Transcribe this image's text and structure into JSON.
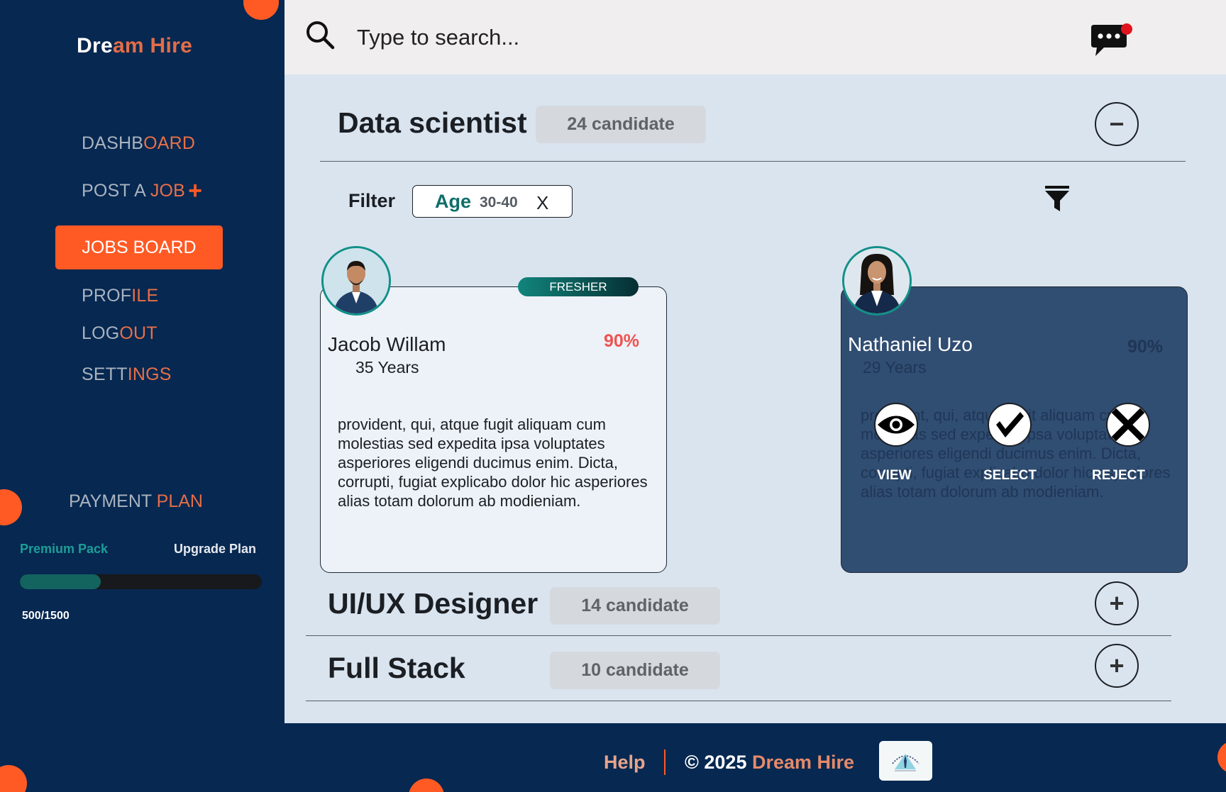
{
  "brand": {
    "part1": "Dre",
    "part2": "am Hire"
  },
  "nav": {
    "dashboard": {
      "a": "DASHB",
      "b": "OARD"
    },
    "post_job": {
      "a": "POST A ",
      "b": "JOB",
      "plus": "+"
    },
    "jobs_board": "JOBS BOARD",
    "profile": {
      "a": "PROF",
      "b": "ILE"
    },
    "logout": {
      "a": "LOG",
      "b": "OUT"
    },
    "settings": {
      "a": "SETT",
      "b": "INGS"
    }
  },
  "payment": {
    "title_a": "PAYMENT ",
    "title_b": "PLAN",
    "plan_name": "Premium Pack",
    "upgrade_label": "Upgrade Plan",
    "used": 500,
    "total": 1500,
    "usage_text": "500/1500"
  },
  "search": {
    "placeholder": "Type to search..."
  },
  "notifications": {
    "has_unread": true
  },
  "sections": [
    {
      "title": "Data scientist",
      "count": "24 candidate",
      "toggle": "−",
      "expanded": true
    },
    {
      "title": "UI/UX Designer",
      "count": "14 candidate",
      "toggle": "+",
      "expanded": false
    },
    {
      "title": "Full Stack",
      "count": "10 candidate",
      "toggle": "+",
      "expanded": false
    }
  ],
  "filter": {
    "label": "Filter",
    "chip_key": "Age",
    "chip_value": "30-40",
    "chip_remove": "X"
  },
  "candidates": [
    {
      "badge": "FRESHER",
      "name": "Jacob Willam",
      "age": "35 Years",
      "match": "90%",
      "bio": "provident, qui, atque fugit aliquam cum molestias sed expedita ipsa voluptates asperiores eligendi  ducimus enim. Dicta, corrupti, fugiat explicabo dolor hic asperiores alias totam dolorum ab modieniam."
    },
    {
      "name": "Nathaniel Uzo",
      "age": "29 Years",
      "match": "90%",
      "bio": "provident, qui, atque fugit aliquam cum molestias sed expedita ipsa voluptates asperiores eligendi  ducimus enim. Dicta, corrupti, fugiat explicabo dolor hic asperiores alias totam dolorum ab modieniam.",
      "actions": {
        "view": "VIEW",
        "select": "SELECT",
        "reject": "REJECT"
      }
    }
  ],
  "footer": {
    "help": "Help",
    "copyright_prefix": "© 2025 ",
    "copyright_brand": "Dream Hire"
  },
  "colors": {
    "navy": "#062851",
    "orange": "#ff5a24",
    "teal": "#119088",
    "content_bg": "#dae4ef"
  }
}
